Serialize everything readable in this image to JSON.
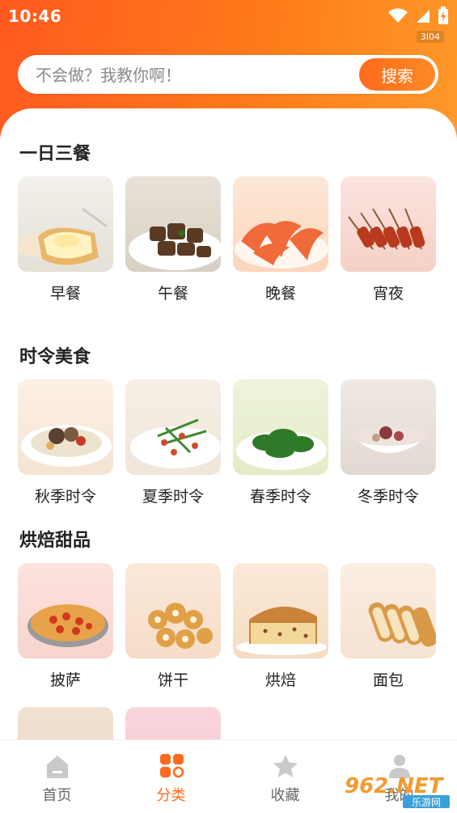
{
  "status": {
    "time": "10:46",
    "badge": "3I04"
  },
  "search": {
    "placeholder": "不会做？我教你啊！",
    "button": "搜索"
  },
  "sections": [
    {
      "title": "一日三餐",
      "items": [
        "早餐",
        "午餐",
        "晚餐",
        "宵夜"
      ]
    },
    {
      "title": "时令美食",
      "items": [
        "秋季时令",
        "夏季时令",
        "春季时令",
        "冬季时令"
      ]
    },
    {
      "title": "烘焙甜品",
      "items": [
        "披萨",
        "饼干",
        "烘焙",
        "面包"
      ]
    }
  ],
  "tabs": [
    {
      "label": "首页",
      "icon": "home-icon"
    },
    {
      "label": "分类",
      "icon": "category-icon"
    },
    {
      "label": "收藏",
      "icon": "star-icon"
    },
    {
      "label": "我的",
      "icon": "user-icon"
    }
  ],
  "watermark": {
    "text": "962.NET",
    "sub": "乐游网"
  },
  "colors": {
    "accent": "#ff6a1d",
    "accent_end": "#ff9a2a"
  }
}
